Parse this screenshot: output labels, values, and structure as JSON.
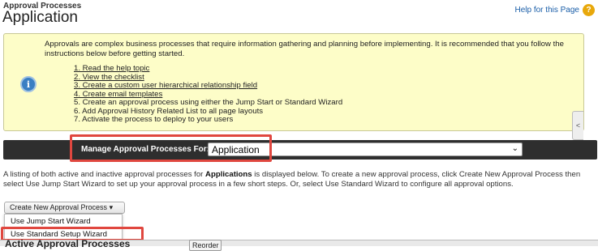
{
  "header": {
    "breadcrumb": "Approval Processes",
    "title": "Application",
    "help_link": "Help for this Page",
    "help_icon": "?"
  },
  "infobox": {
    "icon": "i",
    "intro": "Approvals are complex business processes that require information gathering and planning before implementing. It is recommended that you follow the instructions below before getting started.",
    "steps": [
      "1. Read the help topic",
      "2. View the checklist",
      "3. Create a custom user hierarchical relationship field",
      "4. Create email templates",
      "5. Create an approval process using either the Jump Start or Standard Wizard",
      "6. Add Approval History Related List to all page layouts",
      "7. Activate the process to deploy to your users"
    ],
    "side_tab": "<"
  },
  "manage_bar": {
    "label": "Manage Approval Processes For:",
    "selected": "Application",
    "arrow": "⌄"
  },
  "listing": {
    "before": "A listing of both active and inactive approval processes for ",
    "object": "Applications",
    "after": " is displayed below. To create a new approval process, click Create New Approval Process then select Use Jump Start Wizard to set up your approval process in a few short steps. Or, select Use Standard Wizard to configure all approval options."
  },
  "create_button": {
    "label": "Create New Approval Process",
    "arrow": "▾",
    "menu": [
      "Use Jump Start Wizard",
      "Use Standard Setup Wizard"
    ]
  },
  "section": {
    "title": "Active Approval Processes",
    "reorder": "Reorder"
  },
  "colors": {
    "highlight": "#e0473f",
    "infobox_bg": "#fdfdc8",
    "bar_bg": "#2e2e2e",
    "link": "#1a5ea8"
  }
}
